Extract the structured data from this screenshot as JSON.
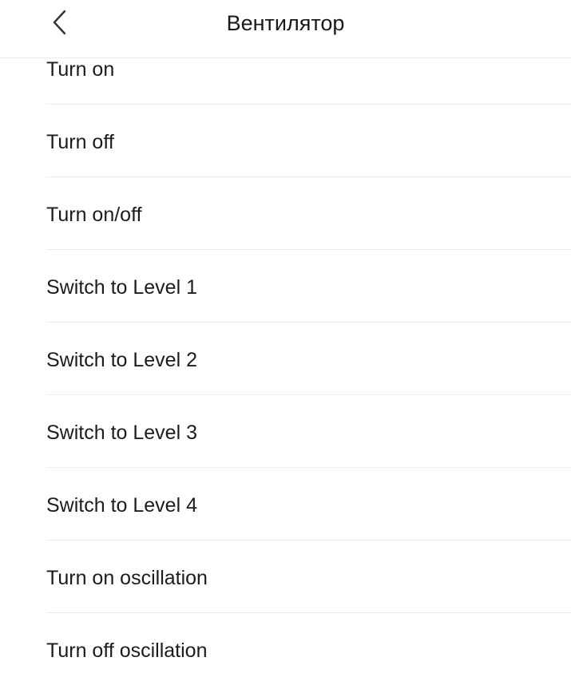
{
  "header": {
    "title": "Вентилятор",
    "back_icon": "chevron-left-icon"
  },
  "actions": [
    {
      "label": "Turn on"
    },
    {
      "label": "Turn off"
    },
    {
      "label": "Turn on/off"
    },
    {
      "label": "Switch to Level 1"
    },
    {
      "label": "Switch to Level 2"
    },
    {
      "label": "Switch to Level 3"
    },
    {
      "label": "Switch to Level 4"
    },
    {
      "label": "Turn on oscillation"
    },
    {
      "label": "Turn off oscillation"
    }
  ]
}
